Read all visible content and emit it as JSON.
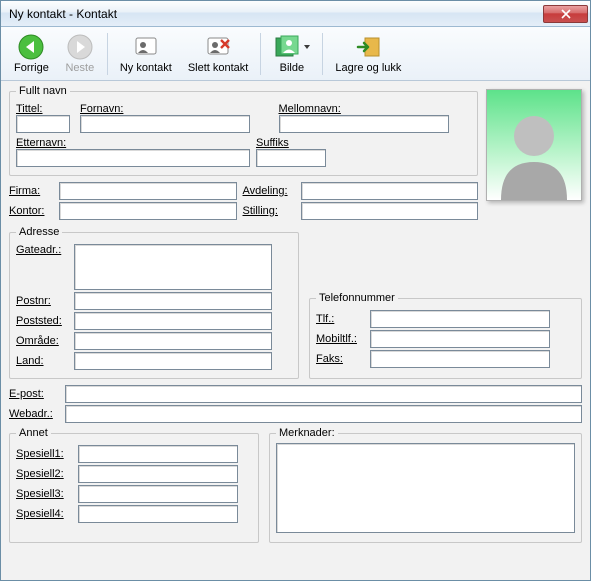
{
  "window": {
    "title": "Ny kontakt - Kontakt"
  },
  "toolbar": {
    "back": "Forrige",
    "next": "Neste",
    "new": "Ny kontakt",
    "delete": "Slett kontakt",
    "image": "Bilde",
    "save": "Lagre og lukk"
  },
  "groups": {
    "fullname": "Fullt navn",
    "address": "Adresse",
    "phone": "Telefonnummer",
    "other": "Annet",
    "notes": "Merknader:"
  },
  "labels": {
    "title": "Tittel:",
    "firstname": "Fornavn:",
    "middlename": "Mellomnavn:",
    "lastname": "Etternavn:",
    "suffix": "Suffiks",
    "company": "Firma:",
    "department": "Avdeling:",
    "office": "Kontor:",
    "position": "Stilling:",
    "street": "Gateadr.:",
    "postno": "Postnr:",
    "poststed": "Poststed:",
    "area": "Område:",
    "country": "Land:",
    "phone_label": "Tlf.:",
    "mobile": "Mobiltlf.:",
    "fax": "Faks:",
    "email": "E-post:",
    "web": "Webadr.:",
    "special1": "Spesiell1:",
    "special2": "Spesiell2:",
    "special3": "Spesiell3:",
    "special4": "Spesiell4:"
  },
  "values": {
    "title": "",
    "firstname": "",
    "middlename": "",
    "lastname": "",
    "suffix": "",
    "company": "",
    "department": "",
    "office": "",
    "position": "",
    "street": "",
    "postno": "",
    "poststed": "",
    "area": "",
    "country": "",
    "phone": "",
    "mobile": "",
    "fax": "",
    "email": "",
    "web": "",
    "special1": "",
    "special2": "",
    "special3": "",
    "special4": "",
    "notes": ""
  }
}
